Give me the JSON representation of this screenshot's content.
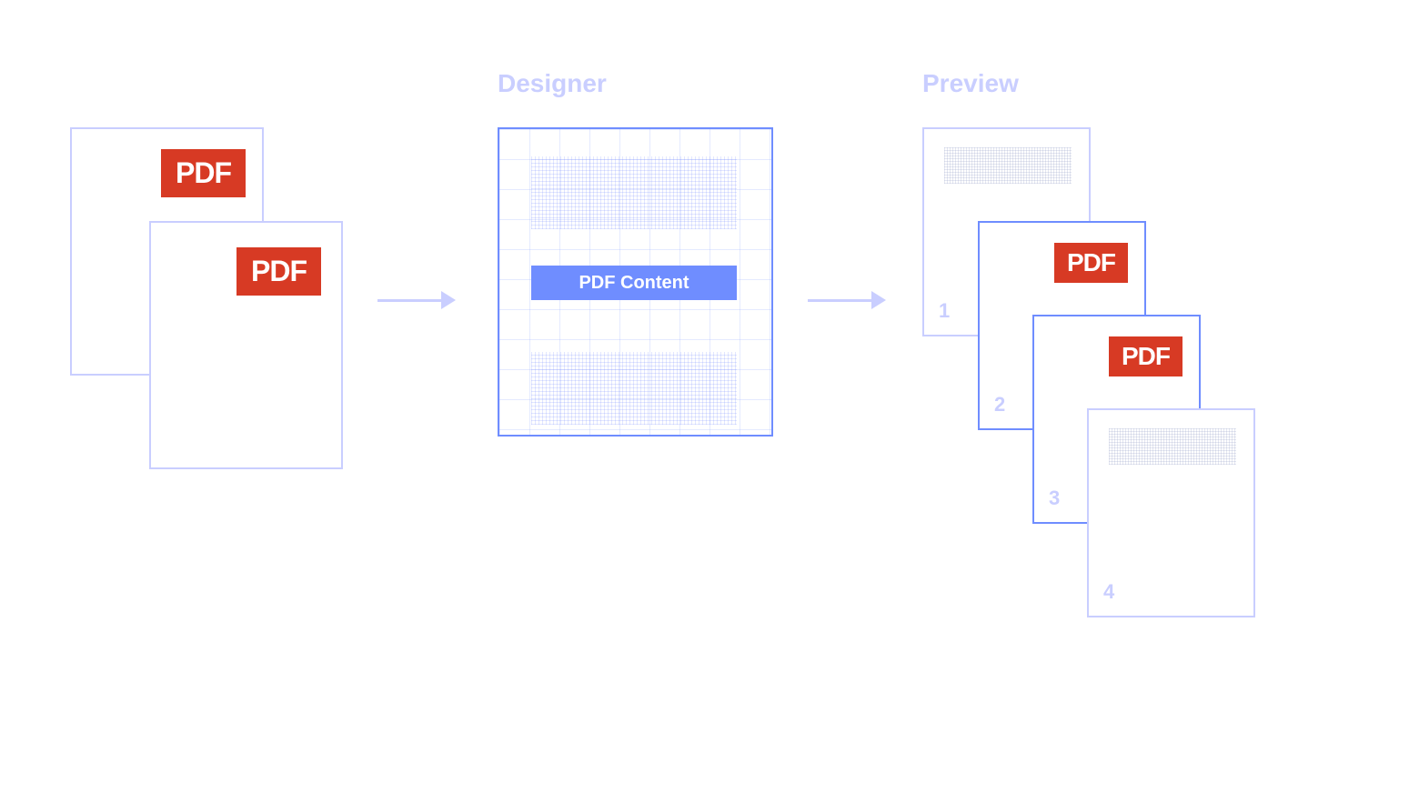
{
  "labels": {
    "designer": "Designer",
    "preview": "Preview"
  },
  "source": {
    "badge_text": "PDF"
  },
  "designer": {
    "content_label": "PDF Content"
  },
  "preview": {
    "pages": [
      {
        "num": "1",
        "has_shaded": true,
        "has_badge": false,
        "highlighted": false
      },
      {
        "num": "2",
        "has_shaded": false,
        "has_badge": true,
        "highlighted": true
      },
      {
        "num": "3",
        "has_shaded": false,
        "has_badge": true,
        "highlighted": true
      },
      {
        "num": "4",
        "has_shaded": true,
        "has_badge": false,
        "highlighted": false
      }
    ],
    "badge_text": "PDF"
  },
  "colors": {
    "accent": "#6f8dff",
    "pale": "#c9ceff",
    "pdf_red": "#d73a24"
  }
}
